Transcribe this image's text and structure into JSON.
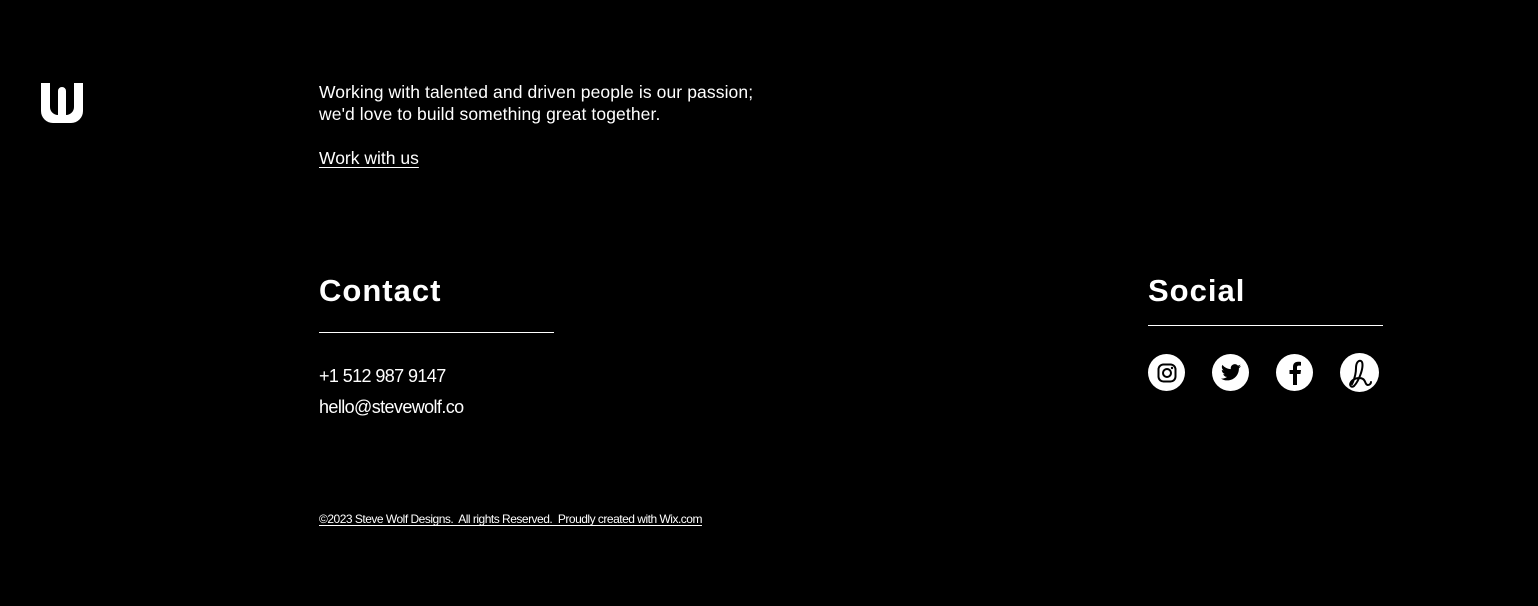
{
  "brand": {
    "logo_icon": "stevewolf-w-logo-icon"
  },
  "intro": {
    "line1": "Working with talented and driven people is our passion;",
    "line2": "we'd love to build something great together.",
    "cta_label": "Work with us"
  },
  "contact": {
    "heading": "Contact",
    "phone": "+1 512 987 9147",
    "email": "hello@stevewolf.co"
  },
  "social": {
    "heading": "Social",
    "links": [
      {
        "name": "instagram",
        "icon": "instagram-icon"
      },
      {
        "name": "twitter",
        "icon": "twitter-icon"
      },
      {
        "name": "facebook",
        "icon": "facebook-icon"
      },
      {
        "name": "dribbble",
        "icon": "dribbble-icon"
      }
    ]
  },
  "footer": {
    "copyright": "©2023 Steve Wolf Designs.  All rights Reserved.  Proudly created with Wix.com"
  },
  "colors": {
    "background": "#000000",
    "foreground": "#ffffff"
  }
}
